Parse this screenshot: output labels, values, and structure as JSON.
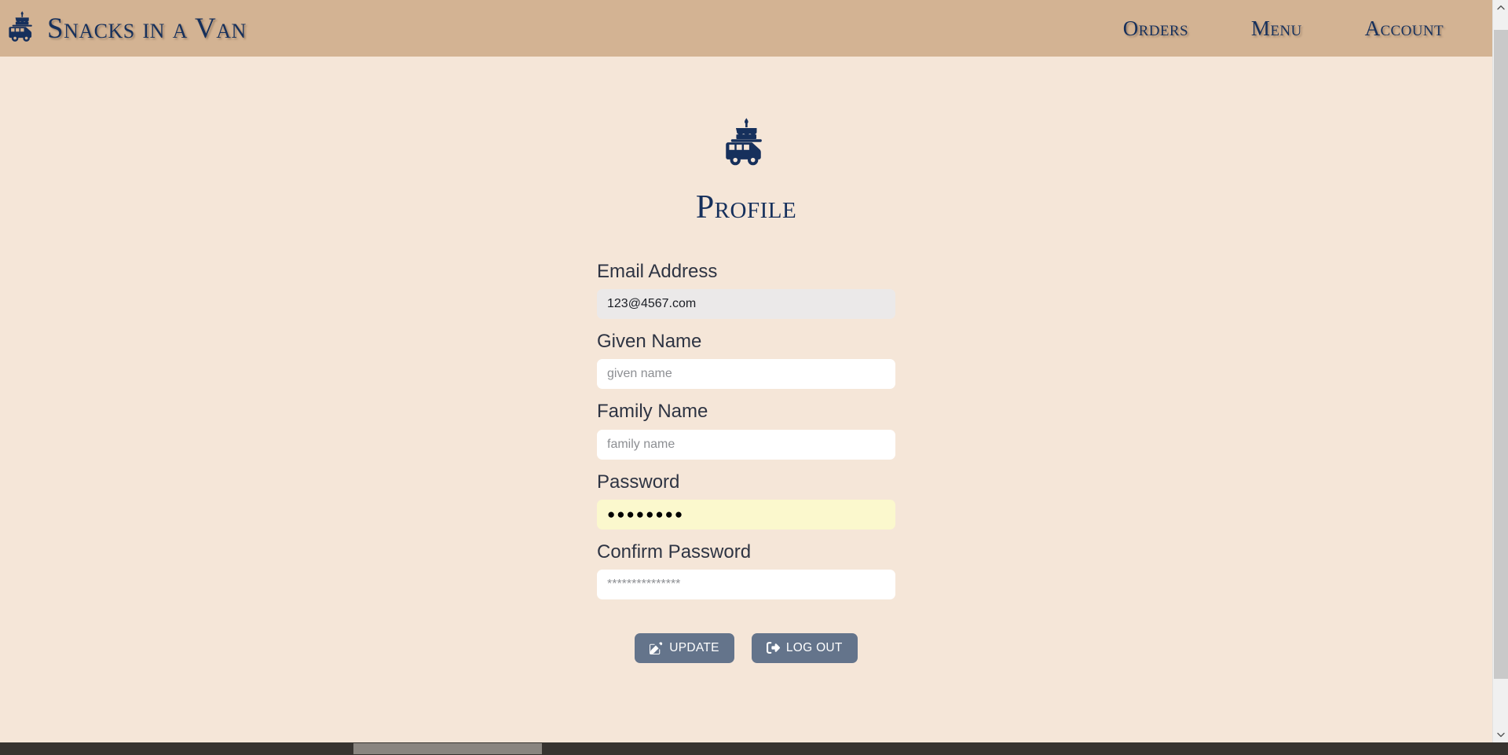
{
  "brand": {
    "icon": "cake-van-icon",
    "title": "Snacks in a Van"
  },
  "nav": {
    "items": [
      {
        "label": "Orders",
        "name": "orders"
      },
      {
        "label": "Menu",
        "name": "menu"
      },
      {
        "label": "Account",
        "name": "account"
      }
    ]
  },
  "main": {
    "hero_icon": "cake-van-icon",
    "title": "Profile"
  },
  "form": {
    "fields": [
      {
        "label": "Email Address",
        "name": "email",
        "value": "123@4567.com",
        "placeholder": "",
        "state": "disabled"
      },
      {
        "label": "Given Name",
        "name": "given-name",
        "value": "",
        "placeholder": "given name",
        "state": "empty"
      },
      {
        "label": "Family Name",
        "name": "family-name",
        "value": "",
        "placeholder": "family name",
        "state": "empty"
      },
      {
        "label": "Password",
        "name": "password",
        "value": "●●●●●●●●",
        "placeholder": "",
        "state": "autofilled"
      },
      {
        "label": "Confirm Password",
        "name": "confirm-password",
        "value": "",
        "placeholder": "***************",
        "state": "empty"
      }
    ],
    "buttons": [
      {
        "label": "UPDATE",
        "name": "update",
        "icon": "pen-to-square-icon"
      },
      {
        "label": "LOG OUT",
        "name": "log-out",
        "icon": "sign-out-icon"
      }
    ]
  },
  "colors": {
    "header_bg": "#d3b393",
    "page_bg": "#f5e6d8",
    "brand_navy": "#16305c",
    "label_text": "#2e3443",
    "button_bg": "#64748b",
    "autofill_yellow": "#fbf8cd",
    "disabled_grey": "#ebe9e9"
  }
}
